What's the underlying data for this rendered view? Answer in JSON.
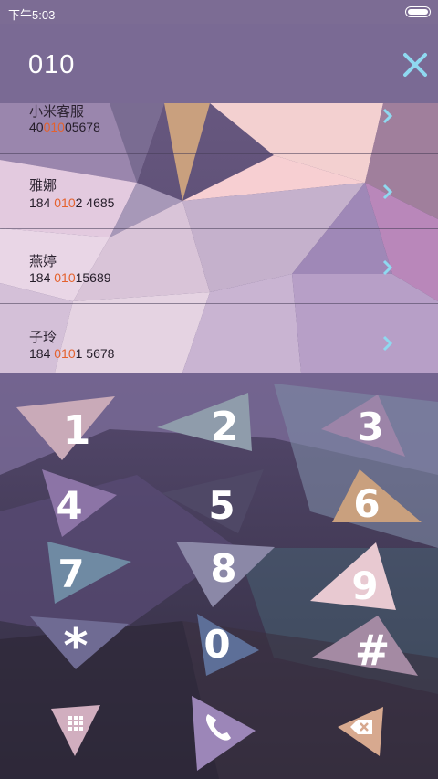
{
  "status_bar": {
    "time": "下午5:03"
  },
  "search": {
    "query": "010"
  },
  "close_button": {
    "icon": "close-icon",
    "color": "#8fd9f0"
  },
  "results": [
    {
      "name": "小米客服",
      "number_parts": [
        "40",
        "010",
        "05678"
      ],
      "highlight_color": "#e4622e"
    },
    {
      "name": "雅娜",
      "number_parts": [
        "184 ",
        "010",
        "2 4685"
      ],
      "highlight_color": "#e4622e"
    },
    {
      "name": "燕婷",
      "number_parts": [
        "184 ",
        "010",
        "15689"
      ],
      "highlight_color": "#e4622e"
    },
    {
      "name": "子玲",
      "number_parts": [
        "184 ",
        "010",
        "1 5678"
      ],
      "highlight_color": "#e4622e"
    }
  ],
  "keypad": {
    "keys": [
      {
        "label": "1",
        "color": "#c9aab8"
      },
      {
        "label": "2",
        "color": "#8f9cab"
      },
      {
        "label": "3",
        "color": "#9c84a8"
      },
      {
        "label": "4",
        "color": "#8c74a6"
      },
      {
        "label": "5",
        "color": "#4f4866"
      },
      {
        "label": "6",
        "color": "#c9a07e"
      },
      {
        "label": "7",
        "color": "#6f8aa3"
      },
      {
        "label": "8",
        "color": "#8b88a7"
      },
      {
        "label": "9",
        "color": "#e8c9d1"
      },
      {
        "label": "*",
        "color": "#6f6b93"
      },
      {
        "label": "0",
        "color": "#5d6f98"
      },
      {
        "label": "#",
        "color": "#a48aa3"
      }
    ],
    "bottom": [
      {
        "name": "dialpad-toggle",
        "icon": "dialpad-icon",
        "color": "#d1aebf"
      },
      {
        "name": "call-button",
        "icon": "phone-icon",
        "color": "#9c86b8"
      },
      {
        "name": "backspace-button",
        "icon": "backspace-icon",
        "color": "#d7a98f"
      }
    ]
  }
}
